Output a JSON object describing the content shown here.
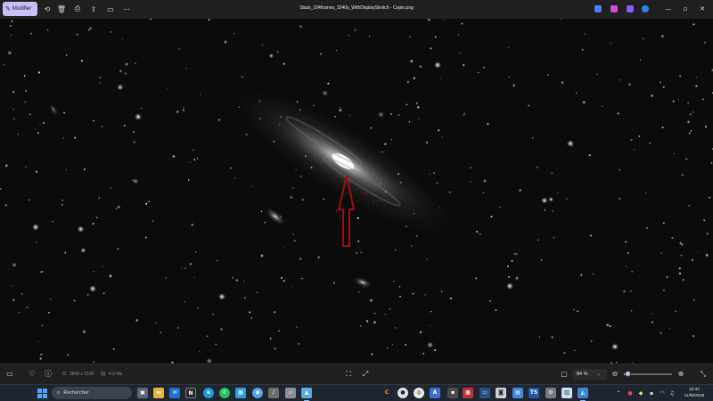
{
  "titlebar": {
    "edit_button_label": "Modifier",
    "file_name": "Stack_104frames_1040s_WithDisplayStretch - Copie.png",
    "accent": "#c9c1f5",
    "tools": [
      "crop-rotate-icon",
      "delete-icon",
      "print-icon",
      "share-icon",
      "slideshow-icon",
      "more-icon"
    ],
    "window_controls": [
      "minimize",
      "maximize",
      "close"
    ]
  },
  "viewer": {
    "subject": "galaxy",
    "annotation": "red-arrow-pointing-up",
    "annotation_color": "#9b0f14"
  },
  "statusbar": {
    "dimensions": "3840 x 2160",
    "file_size": "4.9 Mo",
    "zoom_level": "84 %",
    "zoom_slider_fraction": 0.09
  },
  "taskbar": {
    "search_placeholder": "Rechercher",
    "time": "22:42",
    "date": "11/09/2026",
    "pinned_apps": [
      "file-explorer",
      "mail",
      "notion",
      "edge",
      "whatsapp",
      "chrome",
      "sound",
      "folder",
      "photos"
    ]
  }
}
